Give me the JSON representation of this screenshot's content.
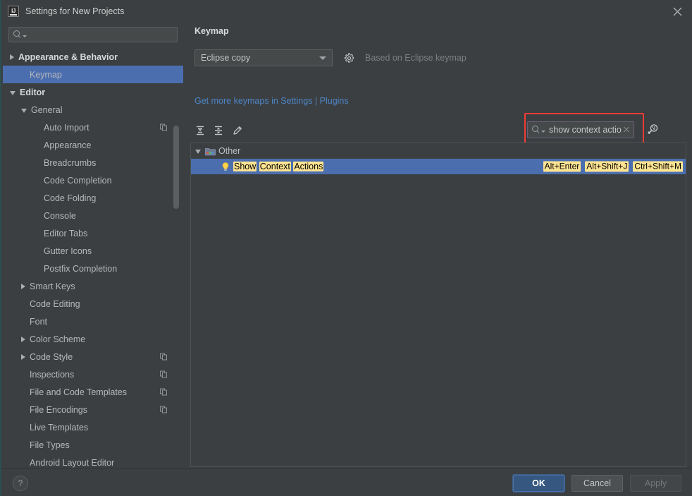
{
  "window": {
    "title": "Settings for New Projects",
    "logo_icon": "intellij-idea-logo-icon",
    "close_icon": "close-icon"
  },
  "sidebar": {
    "search": {
      "placeholder": "",
      "value": "",
      "icon": "search-icon"
    },
    "items": [
      {
        "label": "Appearance & Behavior",
        "level": 0,
        "arrow": "right",
        "selected": false,
        "copy": false
      },
      {
        "label": "Keymap",
        "level": 1,
        "arrow": "none",
        "selected": true,
        "copy": false
      },
      {
        "label": "Editor",
        "level": 0,
        "arrow": "down",
        "selected": false,
        "copy": false
      },
      {
        "label": "General",
        "level": 1,
        "arrow": "down",
        "selected": false,
        "copy": false
      },
      {
        "label": "Auto Import",
        "level": 2,
        "arrow": "none",
        "selected": false,
        "copy": true
      },
      {
        "label": "Appearance",
        "level": 2,
        "arrow": "none",
        "selected": false,
        "copy": false
      },
      {
        "label": "Breadcrumbs",
        "level": 2,
        "arrow": "none",
        "selected": false,
        "copy": false
      },
      {
        "label": "Code Completion",
        "level": 2,
        "arrow": "none",
        "selected": false,
        "copy": false
      },
      {
        "label": "Code Folding",
        "level": 2,
        "arrow": "none",
        "selected": false,
        "copy": false
      },
      {
        "label": "Console",
        "level": 2,
        "arrow": "none",
        "selected": false,
        "copy": false
      },
      {
        "label": "Editor Tabs",
        "level": 2,
        "arrow": "none",
        "selected": false,
        "copy": false
      },
      {
        "label": "Gutter Icons",
        "level": 2,
        "arrow": "none",
        "selected": false,
        "copy": false
      },
      {
        "label": "Postfix Completion",
        "level": 2,
        "arrow": "none",
        "selected": false,
        "copy": false
      },
      {
        "label": "Smart Keys",
        "level": 1,
        "arrow": "right",
        "selected": false,
        "copy": false
      },
      {
        "label": "Code Editing",
        "level": 1,
        "arrow": "none",
        "selected": false,
        "copy": false
      },
      {
        "label": "Font",
        "level": 1,
        "arrow": "none",
        "selected": false,
        "copy": false
      },
      {
        "label": "Color Scheme",
        "level": 1,
        "arrow": "right",
        "selected": false,
        "copy": false
      },
      {
        "label": "Code Style",
        "level": 1,
        "arrow": "right",
        "selected": false,
        "copy": true
      },
      {
        "label": "Inspections",
        "level": 1,
        "arrow": "none",
        "selected": false,
        "copy": true
      },
      {
        "label": "File and Code Templates",
        "level": 1,
        "arrow": "none",
        "selected": false,
        "copy": true
      },
      {
        "label": "File Encodings",
        "level": 1,
        "arrow": "none",
        "selected": false,
        "copy": true
      },
      {
        "label": "Live Templates",
        "level": 1,
        "arrow": "none",
        "selected": false,
        "copy": false
      },
      {
        "label": "File Types",
        "level": 1,
        "arrow": "none",
        "selected": false,
        "copy": false
      },
      {
        "label": "Android Layout Editor",
        "level": 1,
        "arrow": "none",
        "selected": false,
        "copy": false
      }
    ]
  },
  "main": {
    "title": "Keymap",
    "keymap_select": {
      "value": "Eclipse copy",
      "options": [
        "Eclipse copy"
      ]
    },
    "gear_icon": "gear-icon",
    "based_on": "Based on Eclipse keymap",
    "link_prefix": "Get more keymaps in Settings",
    "link_separator": " | ",
    "link_suffix": "Plugins",
    "toolbar": {
      "expand_all_icon": "expand-all-icon",
      "collapse_all_icon": "collapse-all-icon",
      "edit_icon": "edit-pencil-icon",
      "find_by_shortcut_icon": "find-by-keystroke-icon"
    },
    "action_search": {
      "value": "show context action",
      "placeholder": "",
      "icon": "search-icon",
      "clear_icon": "clear-icon"
    },
    "highlight_box_color": "#f23b34",
    "tree": [
      {
        "type": "group",
        "label": "Other",
        "icon": "folder-icon",
        "arrow": "down",
        "selected": false
      },
      {
        "type": "action",
        "icon": "lightbulb-icon",
        "label_parts": [
          {
            "text": "Show",
            "highlight": true
          },
          {
            "text": " ",
            "highlight": false
          },
          {
            "text": "Context",
            "highlight": true
          },
          {
            "text": " ",
            "highlight": false
          },
          {
            "text": "Actions",
            "highlight": true
          }
        ],
        "selected": true,
        "shortcuts": [
          "Alt+Enter",
          "Alt+Shift+J",
          "Ctrl+Shift+M"
        ]
      }
    ]
  },
  "footer": {
    "help_label": "?",
    "ok_label": "OK",
    "cancel_label": "Cancel",
    "apply_label": "Apply"
  }
}
